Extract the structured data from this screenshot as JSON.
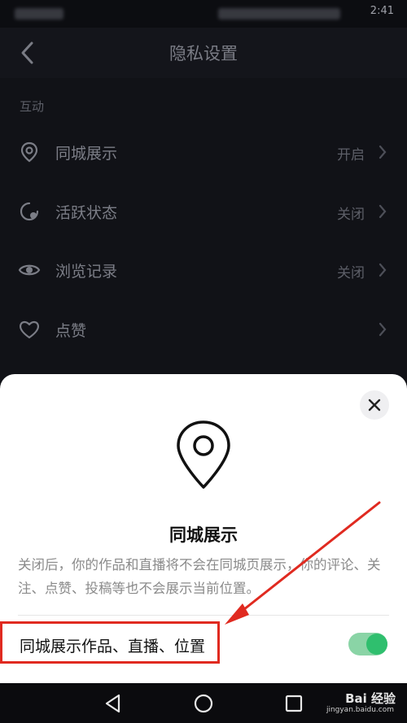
{
  "status_bar": {
    "time": "2:41"
  },
  "header": {
    "title": "隐私设置"
  },
  "section": {
    "label": "互动"
  },
  "rows": [
    {
      "label": "同城展示",
      "value": "开启",
      "icon": "location-pin-icon"
    },
    {
      "label": "活跃状态",
      "value": "关闭",
      "icon": "activity-status-icon"
    },
    {
      "label": "浏览记录",
      "value": "关闭",
      "icon": "eye-icon"
    },
    {
      "label": "点赞",
      "value": "",
      "icon": "heart-icon"
    }
  ],
  "sheet": {
    "title": "同城展示",
    "description": "关闭后，你的作品和直播将不会在同城页展示，你的评论、关注、点赞、投稿等也不会展示当前位置。",
    "toggle_label": "同城展示作品、直播、位置",
    "toggle_state": "on"
  },
  "watermark": {
    "brand": "Bai  经验",
    "url": "jingyan.baidu.com"
  },
  "colors": {
    "background": "#111217",
    "sheet": "#ffffff",
    "toggle_on": "#2fbf6e",
    "annotation_red": "#e02a20"
  }
}
